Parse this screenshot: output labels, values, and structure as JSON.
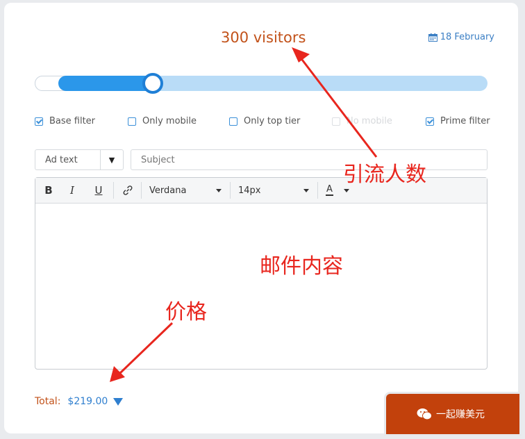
{
  "header": {
    "visitors_label": "300 visitors",
    "date_label": "18 February"
  },
  "slider": {
    "level": 0.26
  },
  "filters": [
    {
      "label": "Base filter",
      "checked": true,
      "disabled": false
    },
    {
      "label": "Only mobile",
      "checked": false,
      "disabled": false
    },
    {
      "label": "Only top tier",
      "checked": false,
      "disabled": false
    },
    {
      "label": "No mobile",
      "checked": false,
      "disabled": true
    },
    {
      "label": "Prime filter",
      "checked": true,
      "disabled": false
    }
  ],
  "form": {
    "ad_type_value": "Ad text",
    "subject_placeholder": "Subject"
  },
  "toolbar": {
    "bold_label": "B",
    "italic_label": "I",
    "underline_label": "U",
    "font_value": "Verdana",
    "size_value": "14px",
    "color_label": "A"
  },
  "annotations": {
    "visitors_note": "引流人数",
    "content_note": "邮件内容",
    "price_note": "价格"
  },
  "footer": {
    "total_label": "Total:",
    "total_value": "$219.00",
    "watermark": "一起赚美元"
  },
  "colors": {
    "accent_orange": "#c2521a",
    "link_blue": "#3b7fc4",
    "slider_fill": "#2b97ea",
    "annotation_red": "#e8261e",
    "cta_orange": "#c2410c"
  }
}
